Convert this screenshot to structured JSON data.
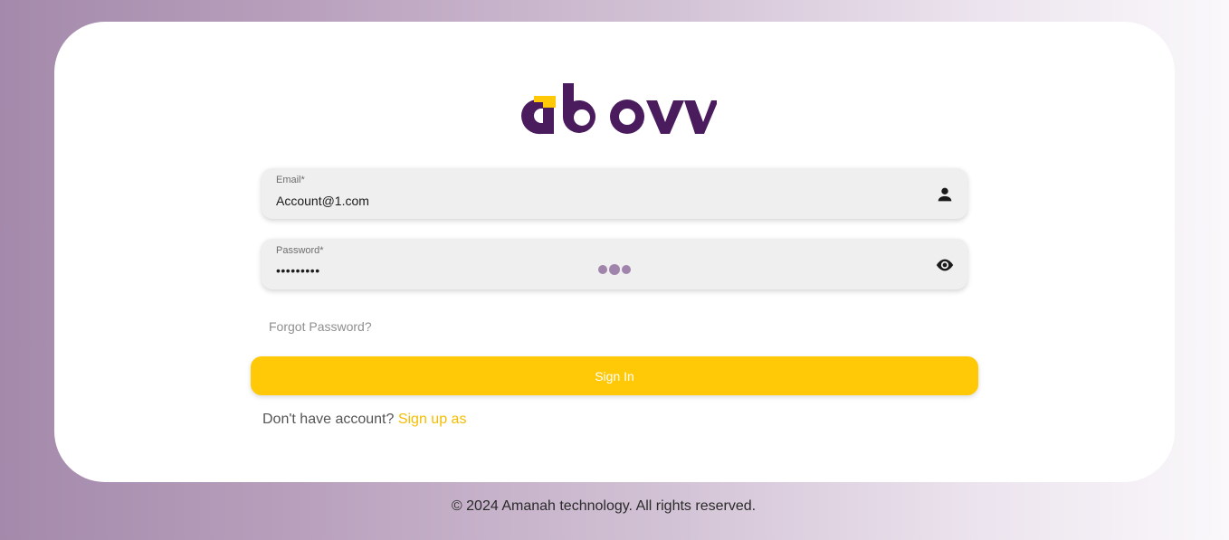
{
  "brand": {
    "logo_text": "abovv",
    "primary_color": "#4a1c5e",
    "accent_color": "#ffc907"
  },
  "form": {
    "email": {
      "label": "Email*",
      "value": "Account@1.com",
      "icon": "person-icon"
    },
    "password": {
      "label": "Password*",
      "value": "•••••••••",
      "icon": "eye-icon"
    },
    "forgot_password": "Forgot Password?",
    "submit_label": "Sign In",
    "signup_prompt": "Don't have account?",
    "signup_link": "Sign up as"
  },
  "footer": {
    "copyright": "© 2024 Amanah technology. All rights reserved."
  }
}
